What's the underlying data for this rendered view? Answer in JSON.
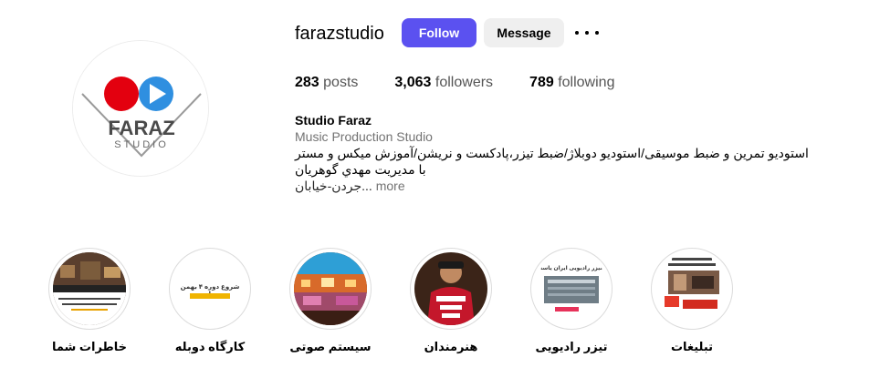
{
  "profile": {
    "username": "farazstudio",
    "follow_label": "Follow",
    "message_label": "Message",
    "avatar_logo_line1": "FARAZ",
    "avatar_logo_line2": "STUDIO"
  },
  "stats": [
    {
      "value": "283",
      "label": "posts"
    },
    {
      "value": "3,063",
      "label": "followers"
    },
    {
      "value": "789",
      "label": "following"
    }
  ],
  "bio": {
    "name": "Studio Faraz",
    "category": "Music Production Studio",
    "line1": "استودیو تمرین و ضبط موسیقی/استودیو دوبلاژ/ضبط تیزر،پادکست و نریشن/آموزش میکس و مستر",
    "line2": "با مدیریت مهدي گوهريان",
    "line3": "جردن-خيابان...",
    "more": "more"
  },
  "highlights": [
    {
      "label": "خاطرات شما",
      "thumb": "drum-room"
    },
    {
      "label": "کارگاه دوبله",
      "thumb": "text-card",
      "thumb_text": "شروع دوره ۴ بهمن ماه"
    },
    {
      "label": "سیستم صوتی",
      "thumb": "stage-lights"
    },
    {
      "label": "هنرمندان",
      "thumb": "artist-portrait"
    },
    {
      "label": "تیزر رادیویی",
      "thumb": "radio-teaser",
      "thumb_text": "تیزر رادیویی ایران یاسا"
    },
    {
      "label": "تبلیغات",
      "thumb": "ads-card"
    }
  ],
  "colors": {
    "follow_bg": "#5b51f0",
    "message_bg": "#efefef",
    "logo_red": "#e3000f",
    "logo_blue": "#2f8fe0"
  }
}
